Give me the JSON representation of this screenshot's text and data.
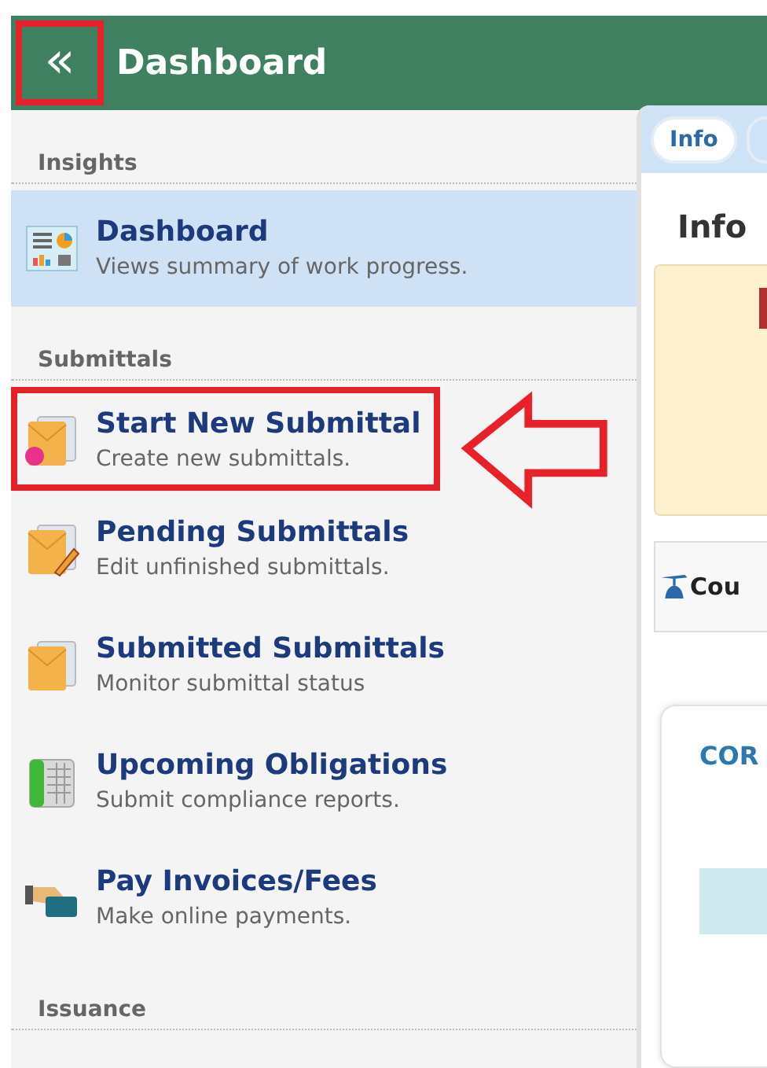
{
  "header": {
    "title": "Dashboard",
    "collapse_icon": "«",
    "annotated": true
  },
  "sidebar": {
    "sections": [
      {
        "label": "Insights",
        "items": [
          {
            "title": "Dashboard",
            "subtitle": "Views summary of work progress.",
            "kind": "dashboard",
            "selected": true,
            "annotated": false
          }
        ]
      },
      {
        "label": "Submittals",
        "items": [
          {
            "title": "Start New Submittal",
            "subtitle": "Create new submittals.",
            "kind": "new-envelope",
            "selected": false,
            "annotated": true
          },
          {
            "title": "Pending Submittals",
            "subtitle": "Edit unfinished submittals.",
            "kind": "edit-envelope",
            "selected": false,
            "annotated": false
          },
          {
            "title": "Submitted Submittals",
            "subtitle": "Monitor submittal status",
            "kind": "envelope",
            "selected": false,
            "annotated": false
          },
          {
            "title": "Upcoming Obligations",
            "subtitle": "Submit compliance reports.",
            "kind": "ledger",
            "selected": false,
            "annotated": false
          },
          {
            "title": "Pay Invoices/Fees",
            "subtitle": "Make online payments.",
            "kind": "payment",
            "selected": false,
            "annotated": false
          }
        ]
      },
      {
        "label": "Issuance"
      }
    ]
  },
  "panel": {
    "tabs": [
      {
        "label": "Info",
        "selected": true
      },
      {
        "selected": false
      }
    ],
    "heading": "Info",
    "notice_button": "Cou",
    "card_title": "COR"
  }
}
